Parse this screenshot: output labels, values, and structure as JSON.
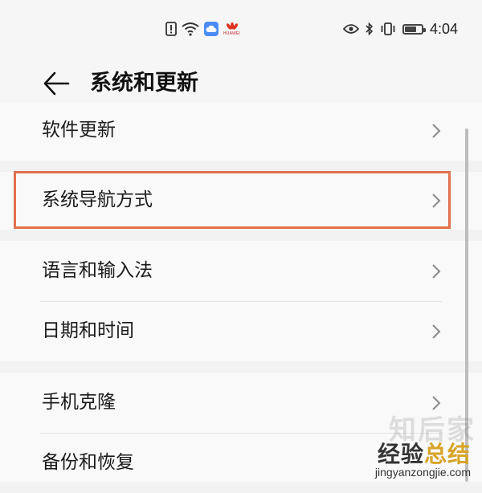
{
  "status_bar": {
    "brand": "HUAWEI",
    "time": "4:04",
    "battery_level": 0.7,
    "left_icons": [
      "alert-icon",
      "wifi-icon",
      "cloud-icon",
      "brand-logo"
    ],
    "right_icons": [
      "eye-icon",
      "bluetooth-icon",
      "vibrate-icon",
      "battery-icon"
    ]
  },
  "header": {
    "title": "系统和更新",
    "back_icon": "arrow-left-icon"
  },
  "settings": {
    "software_update": "软件更新",
    "system_navigation": "系统导航方式",
    "language_input": "语言和输入法",
    "date_time": "日期和时间",
    "phone_clone": "手机克隆",
    "backup_restore": "备份和恢复"
  },
  "highlight_color": "#e1704b",
  "watermark": {
    "ghost": "知后家",
    "part1": "经验",
    "part2": "总结",
    "url": "jingyanzongjie.com"
  }
}
